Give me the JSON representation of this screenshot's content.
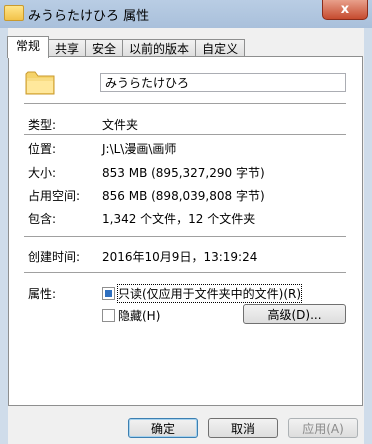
{
  "window": {
    "title": "みうらたけひろ 属性",
    "close_label": "x"
  },
  "tabs": [
    {
      "label": "常规"
    },
    {
      "label": "共享"
    },
    {
      "label": "安全"
    },
    {
      "label": "以前的版本"
    },
    {
      "label": "自定义"
    }
  ],
  "folder": {
    "name": "みうらたけひろ"
  },
  "fields": {
    "type_label": "类型:",
    "type_value": "文件夹",
    "location_label": "位置:",
    "location_value": "J:\\L\\漫画\\画师",
    "size_label": "大小:",
    "size_value": "853 MB (895,327,290 字节)",
    "disk_label": "占用空间:",
    "disk_value": "856 MB (898,039,808 字节)",
    "contains_label": "包含:",
    "contains_value": "1,342 个文件，12 个文件夹",
    "created_label": "创建时间:",
    "created_value": "2016年10月9日，13:19:24",
    "attributes_label": "属性:"
  },
  "attributes": {
    "readonly_label": "只读(仅应用于文件夹中的文件)(R)",
    "hidden_label": "隐藏(H)",
    "advanced_label": "高级(D)..."
  },
  "buttons": {
    "ok": "确定",
    "cancel": "取消",
    "apply": "应用(A)"
  }
}
